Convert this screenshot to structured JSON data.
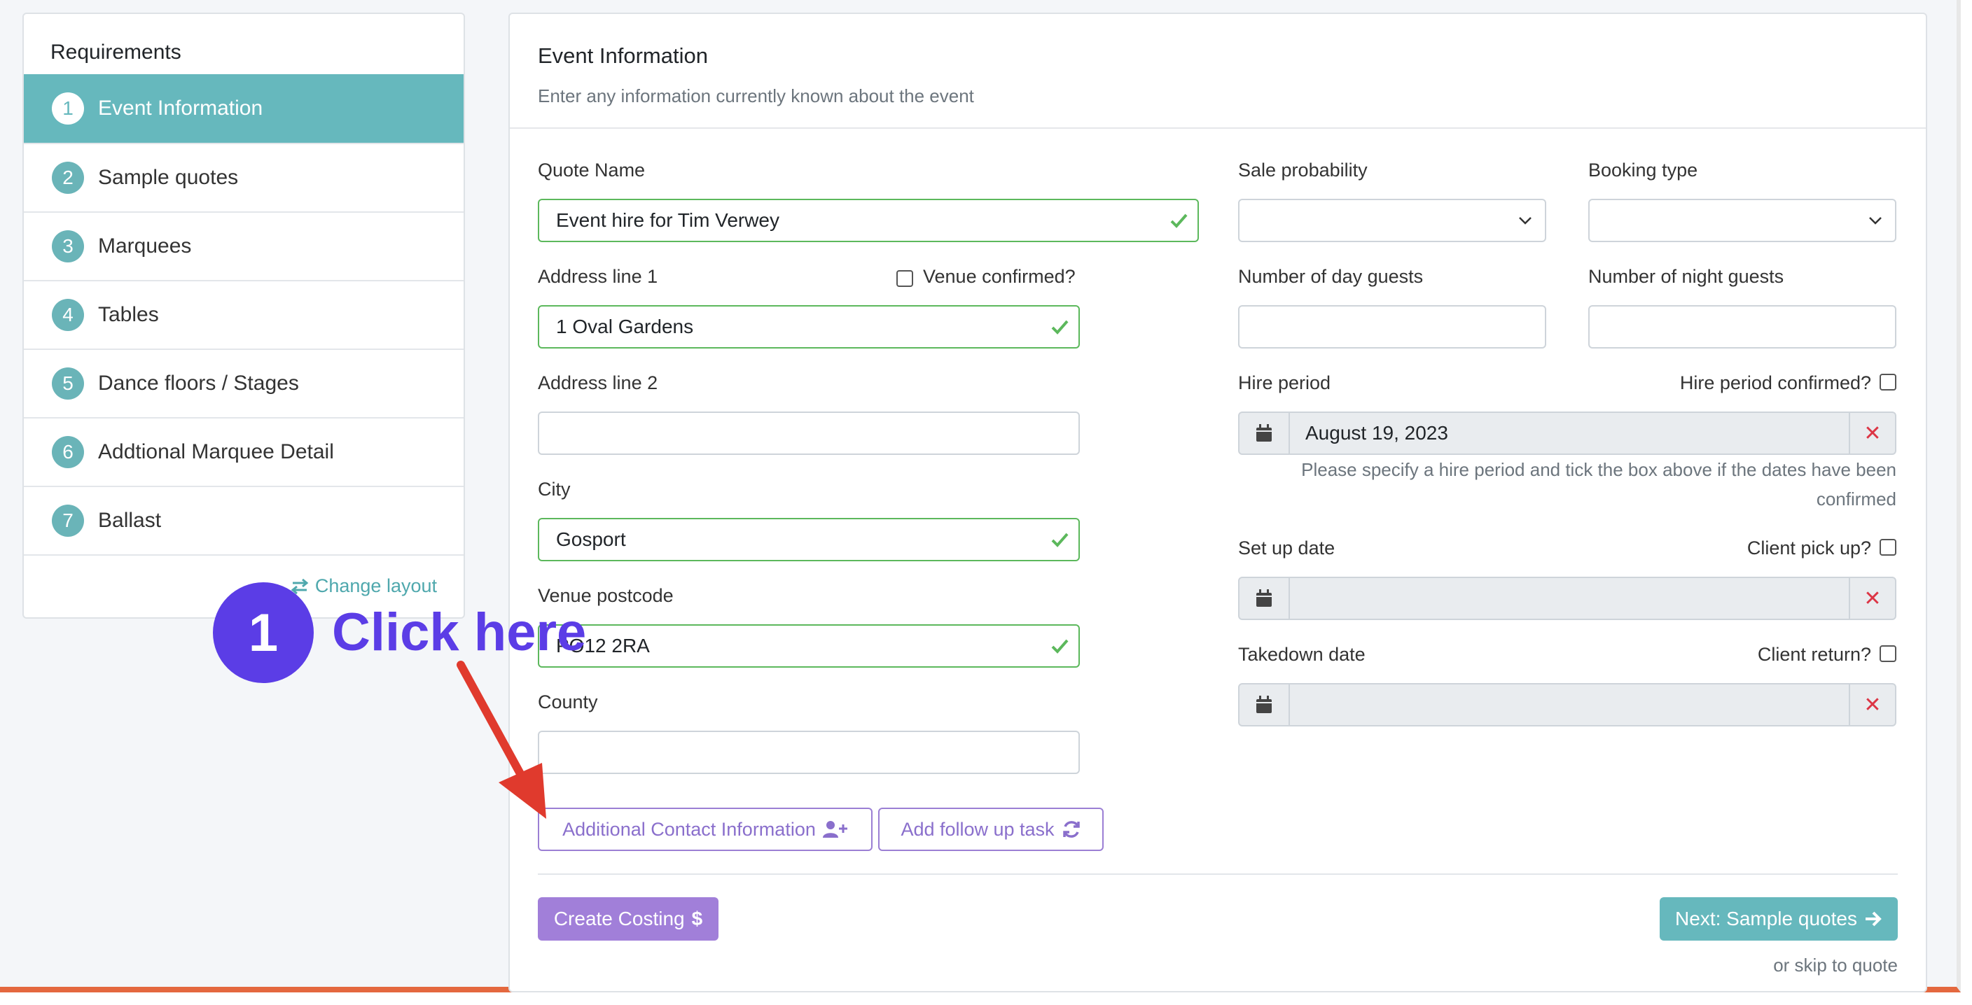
{
  "sidebar": {
    "title": "Requirements",
    "steps": [
      {
        "num": "1",
        "label": "Event Information"
      },
      {
        "num": "2",
        "label": "Sample quotes"
      },
      {
        "num": "3",
        "label": "Marquees"
      },
      {
        "num": "4",
        "label": "Tables"
      },
      {
        "num": "5",
        "label": "Dance floors / Stages"
      },
      {
        "num": "6",
        "label": "Addtional Marquee Detail"
      },
      {
        "num": "7",
        "label": "Ballast"
      }
    ],
    "change_layout": "Change layout"
  },
  "main": {
    "title": "Event Information",
    "subtitle": "Enter any information currently known about the event",
    "quote_name": {
      "label": "Quote Name",
      "value": "Event hire for Tim Verwey"
    },
    "address1": {
      "label": "Address line 1",
      "value": "1 Oval Gardens"
    },
    "venue_confirmed": "Venue confirmed?",
    "address2": {
      "label": "Address line 2",
      "value": ""
    },
    "city": {
      "label": "City",
      "value": "Gosport"
    },
    "postcode": {
      "label": "Venue postcode",
      "value": "PO12 2RA"
    },
    "county": {
      "label": "County",
      "value": ""
    },
    "sale_probability": {
      "label": "Sale probability",
      "value": ""
    },
    "booking_type": {
      "label": "Booking type",
      "value": ""
    },
    "day_guests": {
      "label": "Number of day guests",
      "value": ""
    },
    "night_guests": {
      "label": "Number of night guests",
      "value": ""
    },
    "hire_period": {
      "label": "Hire period",
      "confirmed_label": "Hire period confirmed?",
      "value": "August 19, 2023"
    },
    "hire_help": "Please specify a hire period and tick the box above if the dates have been confirmed",
    "setup_date": {
      "label": "Set up date",
      "extra_label": "Client pick up?",
      "value": ""
    },
    "takedown_date": {
      "label": "Takedown date",
      "extra_label": "Client return?",
      "value": ""
    },
    "btn_additional_contact": "Additional Contact Information",
    "btn_follow_up": "Add follow up task",
    "btn_create_costing": "Create Costing",
    "btn_next": "Next: Sample quotes",
    "skip": "or skip to quote"
  },
  "annotation": {
    "number": "1",
    "text": "Click here",
    "color": "#5b3de6"
  },
  "colors": {
    "teal": "#66b8bd",
    "purple": "#a17fd9",
    "valid": "#5cb85c",
    "danger": "#dc3545"
  }
}
